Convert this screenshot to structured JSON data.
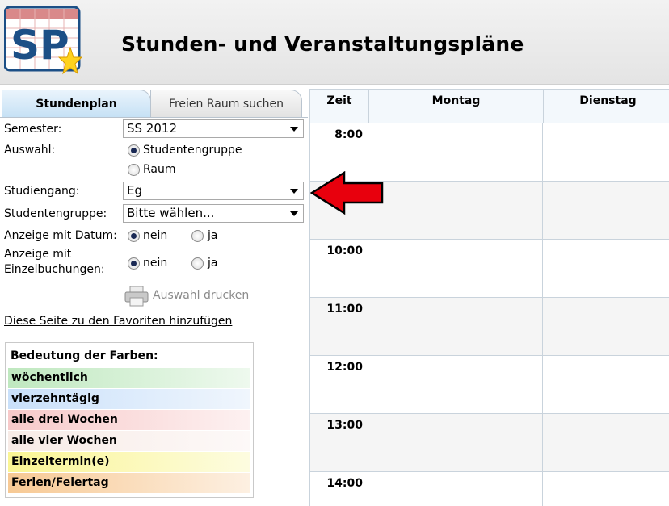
{
  "header": {
    "logo_text": "SP",
    "title": "Stunden- und Veranstaltungspläne"
  },
  "tabs": [
    {
      "label": "Stundenplan",
      "active": true
    },
    {
      "label": "Freien Raum suchen",
      "active": false
    }
  ],
  "form": {
    "semester_label": "Semester:",
    "semester_value": "SS 2012",
    "auswahl_label": "Auswahl:",
    "auswahl_options": [
      {
        "label": "Studentengruppe",
        "checked": true
      },
      {
        "label": "Raum",
        "checked": false
      }
    ],
    "studiengang_label": "Studiengang:",
    "studiengang_value": "Eg",
    "studentengruppe_label": "Studentengruppe:",
    "studentengruppe_value": "Bitte wählen...",
    "anzeige_datum_label": "Anzeige mit Datum:",
    "anzeige_datum_options": [
      {
        "label": "nein",
        "checked": true
      },
      {
        "label": "ja",
        "checked": false
      }
    ],
    "anzeige_einzel_label_1": "Anzeige mit",
    "anzeige_einzel_label_2": "Einzelbuchungen:",
    "anzeige_einzel_options": [
      {
        "label": "nein",
        "checked": true
      },
      {
        "label": "ja",
        "checked": false
      }
    ],
    "print_label": "Auswahl drucken"
  },
  "favorites_link": "Diese Seite zu den Favoriten hinzufügen",
  "legend": {
    "title": "Bedeutung der Farben:",
    "items": [
      {
        "label": "wöchentlich",
        "color": "#c8ecc8"
      },
      {
        "label": "vierzehntägig",
        "color": "#d3e6fb"
      },
      {
        "label": "alle drei Wochen",
        "color": "#f9d2d2"
      },
      {
        "label": "alle vier Wochen",
        "color": "#faf1ee"
      },
      {
        "label": "Einzeltermin(e)",
        "color": "#fbf7a8"
      },
      {
        "label": "Ferien/Feiertag",
        "color": "#f9d6a8"
      }
    ]
  },
  "grid": {
    "columns": [
      "Zeit",
      "Montag",
      "Dienstag"
    ],
    "times": [
      "8:00",
      "",
      "10:00",
      "11:00",
      "12:00",
      "13:00",
      "14:00"
    ]
  },
  "colors": {
    "arrow": "#e8000d",
    "tab_active": "#c6e1f5",
    "logo_blue": "#1c4f86",
    "logo_star": "#ffd21e"
  }
}
